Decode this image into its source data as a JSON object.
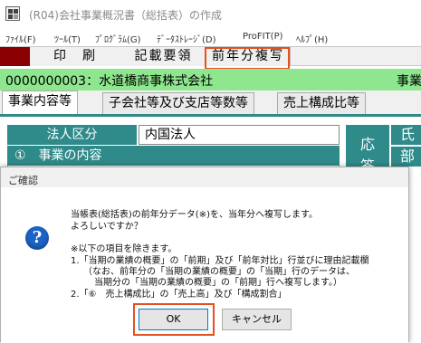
{
  "window": {
    "title": "(R04)会社事業概況書（総括表）の作成"
  },
  "menu": [
    "ﾌｧｲﾙ(F)",
    "ﾂｰﾙ(T)",
    "ﾌﾟﾛｸﾞﾗﾑ(G)",
    "ﾃﾞｰﾀｽﾄﾚｰｼﾞ(D)",
    "ProFIT(P)",
    "ﾍﾙﾌﾟ(H)"
  ],
  "toolbar": {
    "print": "印　刷",
    "entry_guide": "記載要領",
    "copy_prev_year": "前年分複写"
  },
  "company": {
    "code_name": "0000000003：水道橋商事株式会社",
    "right_label": "事業"
  },
  "tabs": [
    "事業内容等",
    "子会社等及び支店等数等",
    "売上構成比等"
  ],
  "form": {
    "corp_type_label": "法人区分",
    "corp_type_value": "内国法人",
    "section_label": "①　事業の内容",
    "side_label_1": "応",
    "side_label_2": "答",
    "right_label_1": "氏",
    "right_label_2": "部"
  },
  "dialog": {
    "title": "ご確認",
    "line1": "当帳表(総括表)の前年分データ(※)を、当年分へ複写します。",
    "line2": "よろしいですか？",
    "line3": "※以下の項目を除きます。",
    "line4": "1.「当期の業績の概要」の「前期」及び「前年対比」行並びに理由記載欄",
    "line5": "（なお、前年分の「当期の業績の概要」の「当期」行のデータは、",
    "line6": "当期分の「当期の業績の概要」の「前期」行へ複写します。）",
    "line7": "2.「⑥　売上構成比」の「売上高」及び「構成割合」",
    "ok": "OK",
    "cancel": "キャンセル"
  },
  "colors": {
    "accent_red": "#e4501e",
    "company_bar": "#8ee68e",
    "header_teal": "#2f8a8a",
    "toolbar_dark_red": "#8b0000"
  }
}
